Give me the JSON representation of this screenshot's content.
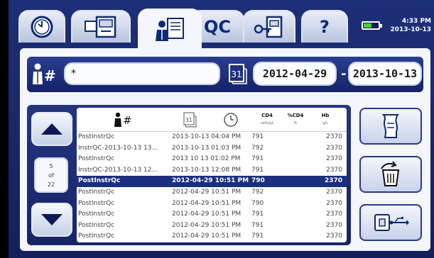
{
  "status": {
    "time": "4:33 PM",
    "date": "2013-10-13",
    "battery_level": 0.55
  },
  "tabs": [
    {
      "name": "history",
      "icon": "clock-icon"
    },
    {
      "name": "instrument",
      "icon": "instrument-icon"
    },
    {
      "name": "patient-records",
      "icon": "patient-records-icon",
      "active": true
    },
    {
      "name": "qc",
      "label": "QC"
    },
    {
      "name": "settings",
      "icon": "key-door-icon"
    },
    {
      "name": "help",
      "label": "?"
    }
  ],
  "filter": {
    "id_value": "*",
    "date_from": "2012-04-29",
    "date_sep": "-",
    "date_to": "2013-10-13"
  },
  "pager": {
    "current": "5",
    "of_label": "of",
    "total": "22"
  },
  "table": {
    "headers": {
      "cd4": "CD4",
      "cd4_unit": "cells/µL",
      "pct": "%CD4",
      "pct_unit": "%",
      "hb": "Hb",
      "hb_unit": "g/L"
    },
    "rows": [
      {
        "id": "PostInstrQc",
        "datetime": "2013-10-13 04:04 PM",
        "cd4": "791",
        "hb": "2370"
      },
      {
        "id": "InstrQC-2013-10-13 13...",
        "datetime": "2013-10-13 01:03 PM",
        "cd4": "792",
        "hb": "2370"
      },
      {
        "id": "PostInstrQc",
        "datetime": "2013 10 13 01:02 PM",
        "cd4": "791",
        "hb": "2370"
      },
      {
        "id": "InstrQC-2013-10-13 12...",
        "datetime": "2013-10-13 12:08 PM",
        "cd4": "791",
        "hb": "2370"
      },
      {
        "id": "PostInstrQc",
        "datetime": "2012-04-29 10:51 PM",
        "cd4": "790",
        "hb": "2370",
        "selected": true
      },
      {
        "id": "PostInstrQc",
        "datetime": "2012-04-29 10:51 PM",
        "cd4": "792",
        "hb": "2370"
      },
      {
        "id": "PostInstrQc",
        "datetime": "2012-04-29 10:51 PM",
        "cd4": "790",
        "hb": "2370"
      },
      {
        "id": "PostInstrQc",
        "datetime": "2012-04-29 10:51 PM",
        "cd4": "791",
        "hb": "2370"
      },
      {
        "id": "PostInstrQc",
        "datetime": "2012-04-29 10:51 PM",
        "cd4": "791",
        "hb": "2370"
      },
      {
        "id": "PostInstrQc",
        "datetime": "2012-04-29 10:51 PM",
        "cd4": "791",
        "hb": "2370"
      }
    ]
  },
  "actions": [
    {
      "name": "print-button",
      "icon": "paper-roll-icon"
    },
    {
      "name": "delete-button",
      "icon": "trash-icon"
    },
    {
      "name": "usb-export-button",
      "icon": "usb-icon"
    }
  ]
}
